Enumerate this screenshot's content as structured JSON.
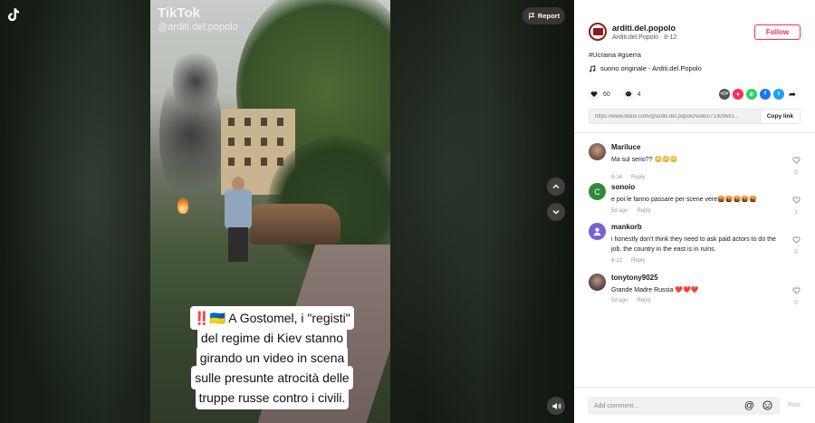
{
  "player": {
    "report_label": "Report",
    "watermark": "TikTok",
    "watermark_handle": "@arditi.del.popolo",
    "caption_lines": [
      "‼️🇺🇦 A Gostomel, i \"registi\"",
      "del regime di Kiev stanno",
      "girando un video in scena",
      "sulle presunte atrocità delle",
      "truppe russe contro i civili."
    ]
  },
  "author": {
    "name": "arditi.del.popolo",
    "display_name": "Arditi.del.Popolo",
    "date": "8-12",
    "follow_label": "Follow"
  },
  "post": {
    "hashtags": "#Ucraina #guerra",
    "sound": "suono originale - Arditi.del.Popolo",
    "likes": "60",
    "comments": "4",
    "link": "https://www.tiktok.com/@arditi.del.popolo/video/71309591...",
    "copy_label": "Copy link"
  },
  "comments": [
    {
      "user": "Mariluce",
      "text": "Ma sul serio?? 😳😳😳",
      "date": "8-14",
      "reply": "Reply",
      "likes": "0"
    },
    {
      "user": "sonoio",
      "text": "e poi le fanno passare per scene vere🤬🤬🤬🤬🤬",
      "date": "5d ago",
      "reply": "Reply",
      "likes": "1"
    },
    {
      "user": "mankorb",
      "text": "i honestly don't think they need to ask paid actors to do the job. the country in the east is in ruins.",
      "date": "8-13",
      "reply": "Reply",
      "likes": "0"
    },
    {
      "user": "tonytony9025",
      "text": "Grande Madre Russia ❤️❤️❤️",
      "date": "5d ago",
      "reply": "Reply",
      "likes": "0"
    }
  ],
  "composer": {
    "placeholder": "Add comment...",
    "post_label": "Post"
  },
  "colors": {
    "accent": "#fe2c55",
    "whatsapp": "#25d366",
    "facebook": "#1877f2",
    "twitter": "#1da1f2"
  }
}
